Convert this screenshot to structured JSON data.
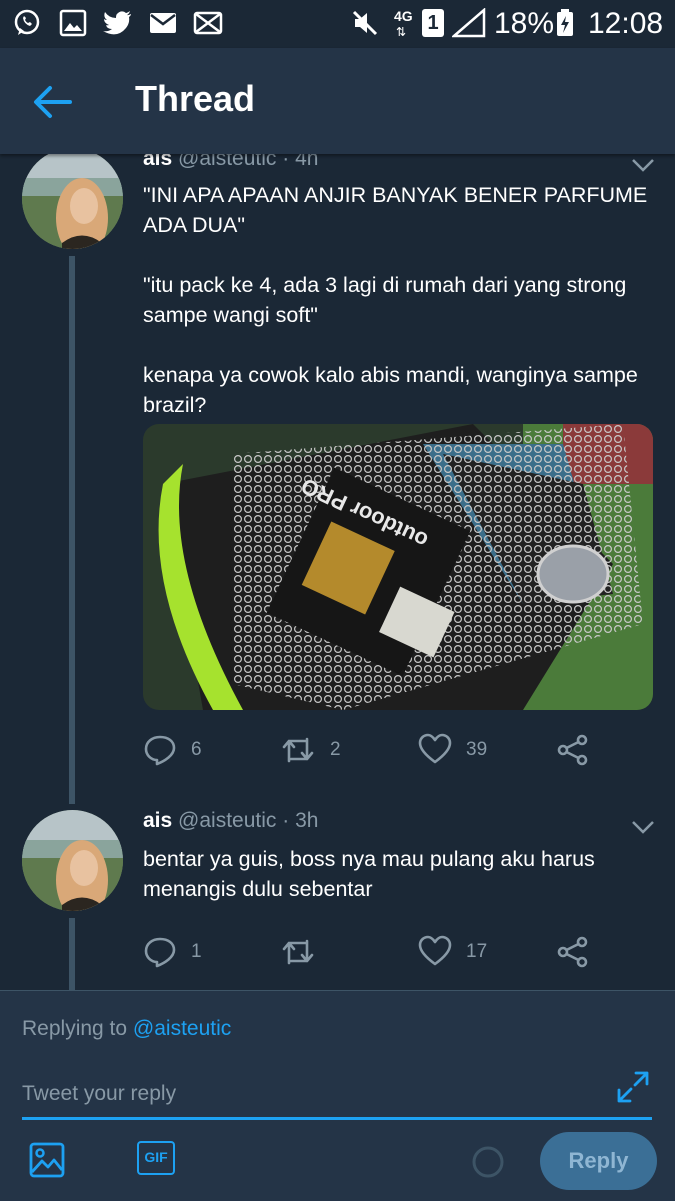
{
  "status_bar": {
    "battery": "18%",
    "time": "12:08",
    "network": "4G",
    "sim": "1"
  },
  "header": {
    "title": "Thread"
  },
  "tweets": [
    {
      "name": "ais",
      "handle": "@aisteutic",
      "time": "4h",
      "text": "\"INI APA APAAN ANJIR BANYAK BENER PARFUME ADA DUA\"\n\n\"itu pack ke 4, ada 3 lagi di rumah dari yang strong sampe wangi soft\"\n\nkenapa ya cowok kalo abis mandi, wanginya sampe brazil?",
      "replies": "6",
      "retweets": "2",
      "likes": "39",
      "media_text": "outdoor PRO"
    },
    {
      "name": "ais",
      "handle": "@aisteutic",
      "time": "3h",
      "text": "bentar ya guis, boss nya mau pulang aku harus menangis dulu sebentar",
      "replies": "1",
      "retweets": "",
      "likes": "17"
    }
  ],
  "reply_box": {
    "replying_to_prefix": "Replying to",
    "replying_to_handle": "@aisteutic",
    "placeholder": "Tweet your reply",
    "gif_label": "GIF",
    "reply_button": "Reply"
  },
  "colors": {
    "background": "#1b2836",
    "header_bg": "#243447",
    "accent": "#1da1f2",
    "secondary_text": "#8899a6"
  }
}
